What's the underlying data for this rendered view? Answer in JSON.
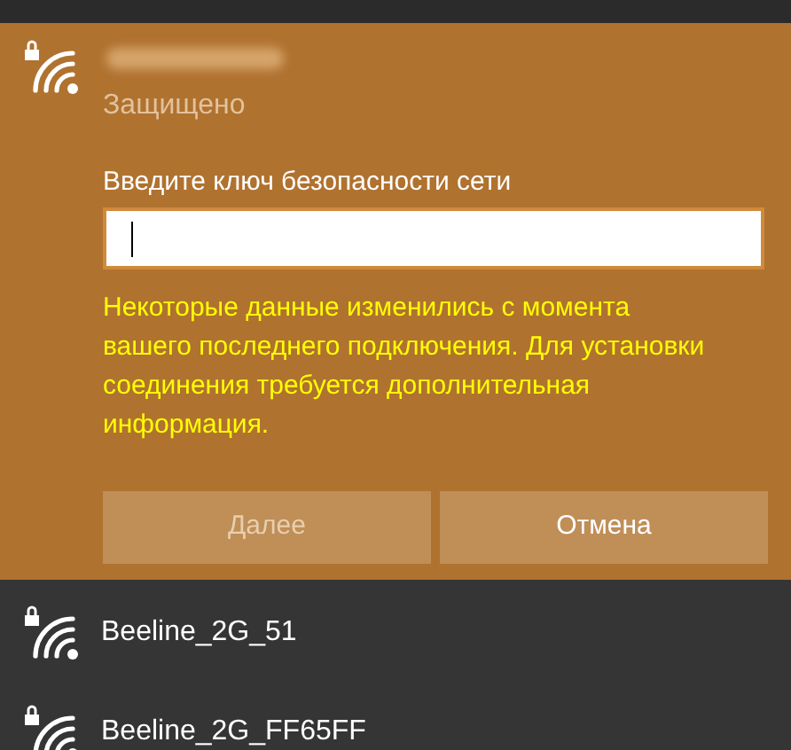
{
  "connecting_network": {
    "secured": true,
    "status": "Защищено",
    "prompt": "Введите ключ безопасности сети",
    "warning": "Некоторые данные изменились с момента вашего последнего подключения. Для установки соединения требуется дополнительная информация.",
    "buttons": [
      {
        "label": "Далее",
        "disabled": true
      },
      {
        "label": "Отмена",
        "disabled": false
      }
    ]
  },
  "networks": [
    {
      "name": "Beeline_2G_51",
      "secured": true
    },
    {
      "name": "Beeline_2G_FF65FF",
      "secured": true
    }
  ]
}
